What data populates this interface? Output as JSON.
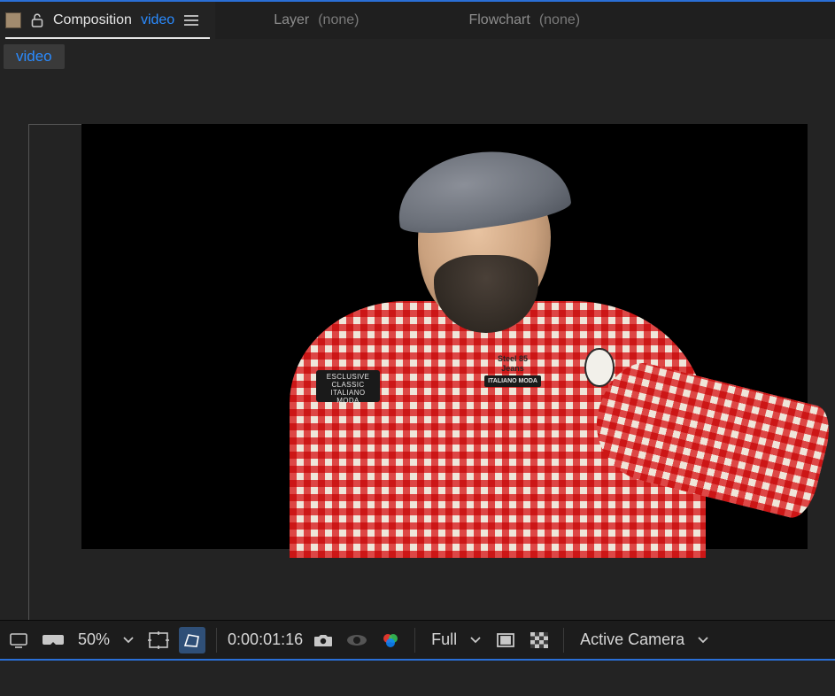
{
  "tabs": {
    "composition": {
      "label": "Composition",
      "name": "video"
    },
    "layer": {
      "label": "Layer",
      "none": "(none)"
    },
    "flowchart": {
      "label": "Flowchart",
      "none": "(none)"
    }
  },
  "breadcrumb": {
    "item0": "video"
  },
  "preview": {
    "patch_left_line1": "ESCLUSIVE CLASSIC",
    "patch_left_line2": "ITALIANO MODA",
    "patch_right_brand": "Steel 85",
    "patch_right_sub": "Jeans",
    "patch_right_bar": "ITALIANO MODA"
  },
  "toolbar": {
    "zoom": "50%",
    "timecode": "0:00:01:16",
    "resolution": "Full",
    "camera": "Active Camera"
  }
}
